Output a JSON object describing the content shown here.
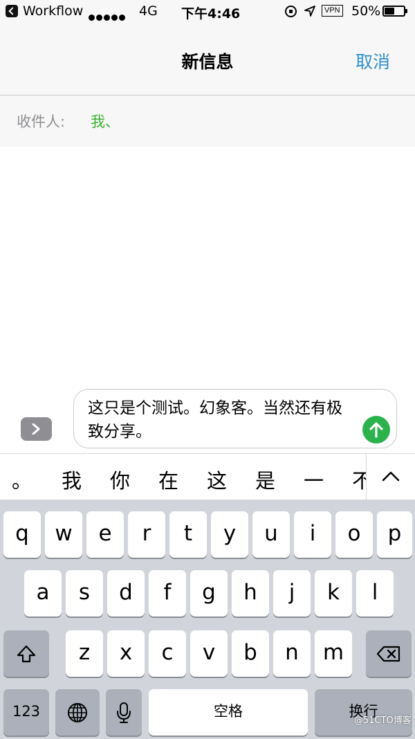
{
  "status_bar": {
    "back_app": "Workflow",
    "network": "4G",
    "time": "下午4:46",
    "vpn": "VPN",
    "battery_text": "50%",
    "battery_level": 0.5
  },
  "nav": {
    "title": "新信息",
    "cancel_label": "取消"
  },
  "recipient": {
    "label": "收件人:",
    "value": "我、"
  },
  "composer": {
    "text": "这只是个测试。幻象客。当然还有极致分享。"
  },
  "candidates": [
    "。",
    "我",
    "你",
    "在",
    "这",
    "是",
    "一",
    "不"
  ],
  "keyboard": {
    "row1": [
      "q",
      "w",
      "e",
      "r",
      "t",
      "y",
      "u",
      "i",
      "o",
      "p"
    ],
    "row2": [
      "a",
      "s",
      "d",
      "f",
      "g",
      "h",
      "j",
      "k",
      "l"
    ],
    "row3": [
      "z",
      "x",
      "c",
      "v",
      "b",
      "n",
      "m"
    ],
    "numbers_key": "123",
    "space_key": "空格",
    "return_key": "换行"
  },
  "watermark": "@51CTO博客",
  "colors": {
    "accent": "#2f8fd3",
    "recipient": "#3db234",
    "send": "#2bb24c",
    "keyboard_bg": "#d1d5db"
  }
}
